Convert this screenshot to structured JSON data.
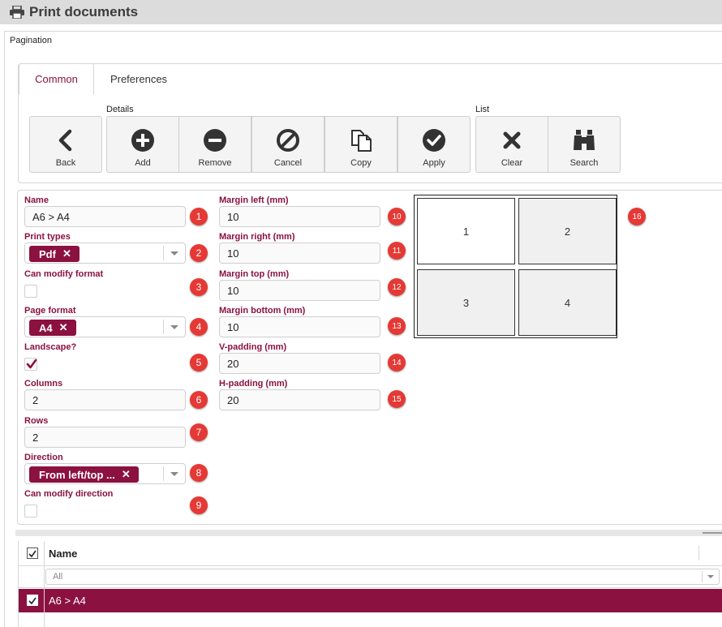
{
  "window": {
    "title": "Print documents",
    "icon": "print-icon"
  },
  "panel": {
    "label": "Pagination"
  },
  "tabs": [
    {
      "label": "Common",
      "active": true
    },
    {
      "label": "Preferences",
      "active": false
    }
  ],
  "toolbar": {
    "details_label": "Details",
    "list_label": "List",
    "buttons": {
      "back": "Back",
      "add": "Add",
      "remove": "Remove",
      "cancel": "Cancel",
      "copy": "Copy",
      "apply": "Apply",
      "clear": "Clear",
      "search": "Search"
    }
  },
  "form": {
    "name": {
      "label": "Name",
      "value": "A6 > A4"
    },
    "print_types": {
      "label": "Print types",
      "chip": "Pdf"
    },
    "can_modify_format": {
      "label": "Can modify format",
      "checked": false
    },
    "page_format": {
      "label": "Page format",
      "chip": "A4"
    },
    "landscape": {
      "label": "Landscape?",
      "checked": true
    },
    "columns": {
      "label": "Columns",
      "value": "2"
    },
    "rows": {
      "label": "Rows",
      "value": "2"
    },
    "direction": {
      "label": "Direction",
      "chip": "From left/top ..."
    },
    "can_modify_direction": {
      "label": "Can modify direction",
      "checked": false
    },
    "margin_left": {
      "label": "Margin left (mm)",
      "value": "10"
    },
    "margin_right": {
      "label": "Margin right (mm)",
      "value": "10"
    },
    "margin_top": {
      "label": "Margin top (mm)",
      "value": "10"
    },
    "margin_bottom": {
      "label": "Margin bottom (mm)",
      "value": "10"
    },
    "v_padding": {
      "label": "V-padding (mm)",
      "value": "20"
    },
    "h_padding": {
      "label": "H-padding (mm)",
      "value": "20"
    }
  },
  "badges": [
    "1",
    "2",
    "3",
    "4",
    "5",
    "6",
    "7",
    "8",
    "9",
    "10",
    "11",
    "12",
    "13",
    "14",
    "15",
    "16"
  ],
  "preview": {
    "cells": [
      "1",
      "2",
      "3",
      "4"
    ]
  },
  "grid": {
    "header": {
      "name": "Name"
    },
    "filter": {
      "value": "All"
    },
    "rows": [
      {
        "name": "A6 > A4",
        "selected": true
      }
    ]
  },
  "colors": {
    "accent": "#8b1140",
    "badge": "#e53935"
  }
}
